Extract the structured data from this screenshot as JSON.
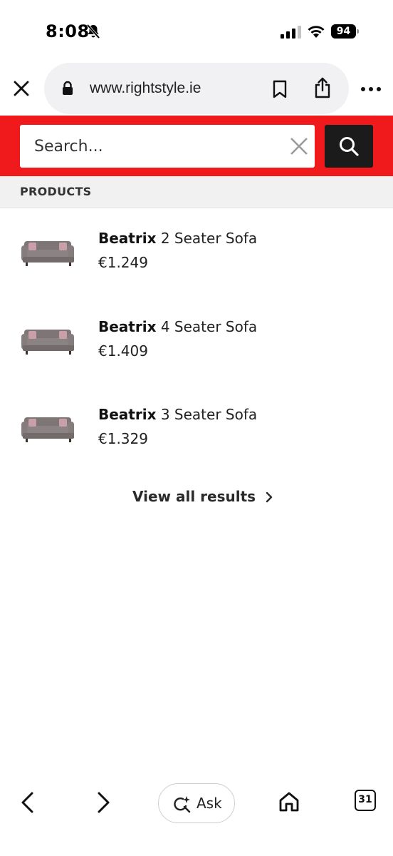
{
  "status_bar": {
    "time": "8:08",
    "battery_level": "94",
    "icons": [
      "bell-slash-icon",
      "signal-icon",
      "wifi-icon",
      "battery-icon"
    ]
  },
  "browser": {
    "url": "www.rightstyle.ie",
    "icons": [
      "close-icon",
      "lock-icon",
      "bookmark-icon",
      "share-icon",
      "more-icon"
    ]
  },
  "search": {
    "placeholder": "Search...",
    "value": "",
    "accent_color": "#f01a1c",
    "button_color": "#1b1b1b"
  },
  "products": {
    "header": "PRODUCTS",
    "items": [
      {
        "brand": "Beatrix",
        "name": "2 Seater Sofa",
        "price": "€1.249",
        "image": "sofa-thumbnail"
      },
      {
        "brand": "Beatrix",
        "name": "4 Seater Sofa",
        "price": "€1.409",
        "image": "sofa-thumbnail"
      },
      {
        "brand": "Beatrix",
        "name": "3 Seater Sofa",
        "price": "€1.329",
        "image": "sofa-thumbnail"
      }
    ],
    "view_all_label": "View all results"
  },
  "toolbar": {
    "ask_label": "Ask",
    "tabs_count": "31",
    "icons": [
      "back-icon",
      "forward-icon",
      "ask-icon",
      "home-icon",
      "tabs-icon"
    ]
  }
}
